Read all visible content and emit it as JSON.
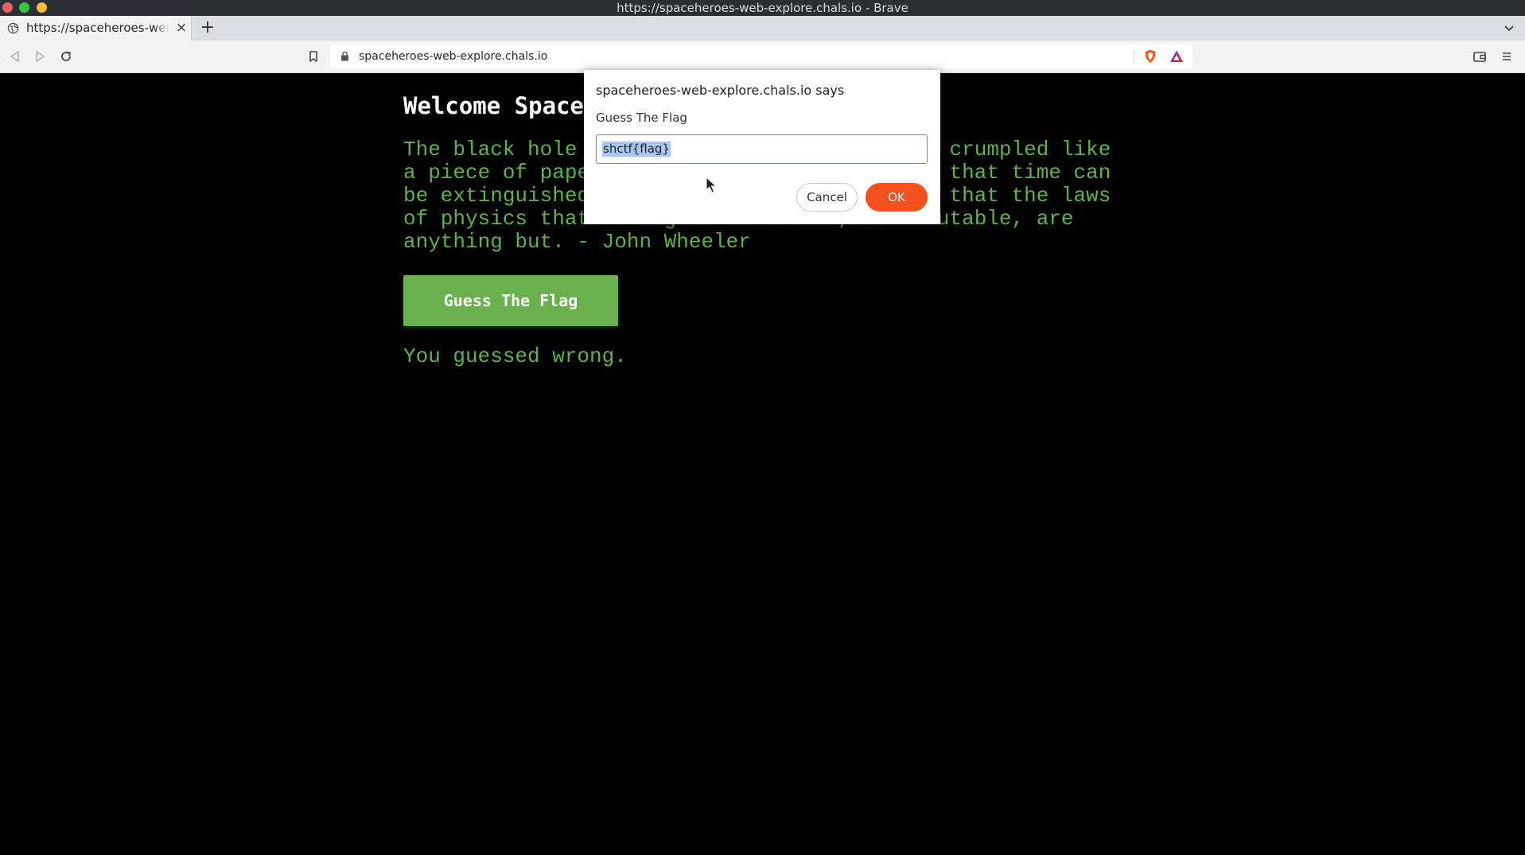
{
  "window": {
    "title": "https://spaceheroes-web-explore.chals.io - Brave"
  },
  "tabs": [
    {
      "title": "https://spaceheroes-web-explore.chals.io",
      "close_glyph": "×",
      "icon": "globe-icon"
    }
  ],
  "tabstrip": {
    "new_tab_glyph": "+"
  },
  "toolbar": {
    "url": "spaceheroes-web-explore.chals.io"
  },
  "page": {
    "heading": "Welcome Space",
    "quote": "The black hole teaches us that space can be crumpled like a piece of paper into an infinitesimal dot, that time can be extinguished like a blown-out flame, and that the laws of physics that we regard as sacred, as immutable, are anything but. - John Wheeler",
    "button_label": "Guess The Flag",
    "result": "You guessed wrong."
  },
  "dialog": {
    "origin": "spaceheroes-web-explore.chals.io says",
    "message": "Guess The Flag",
    "input_value": "shctf{flag}",
    "cancel_label": "Cancel",
    "ok_label": "OK"
  },
  "colors": {
    "page_background": "#000000",
    "text_green": "#5fb24c",
    "button_green": "#6ab04c",
    "dialog_ok": "#f5501f",
    "input_focus_border": "#f25e34"
  }
}
